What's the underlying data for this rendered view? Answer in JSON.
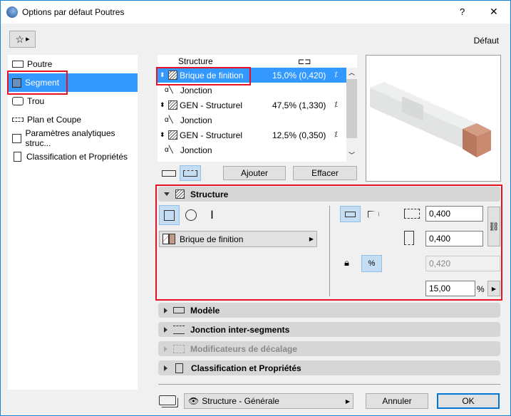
{
  "window": {
    "title": "Options par défaut Poutres",
    "help": "?",
    "close": "✕",
    "preset": "Défaut"
  },
  "sidebar": {
    "items": [
      {
        "label": "Poutre"
      },
      {
        "label": "Segment"
      },
      {
        "label": "Trou"
      },
      {
        "label": "Plan et Coupe"
      },
      {
        "label": "Paramètres analytiques struc..."
      },
      {
        "label": "Classification et Propriétés"
      }
    ]
  },
  "list": {
    "header": "Structure",
    "rows": [
      {
        "type": "segment",
        "name": "Brique de finition",
        "value": "15,0% (0,420)"
      },
      {
        "type": "joint",
        "name": "Jonction"
      },
      {
        "type": "segment",
        "name": "GEN - Structurel",
        "value": "47,5% (1,330)"
      },
      {
        "type": "joint",
        "name": "Jonction"
      },
      {
        "type": "segment",
        "name": "GEN - Structurel",
        "value": "12,5% (0,350)"
      },
      {
        "type": "joint",
        "name": "Jonction"
      }
    ],
    "add": "Ajouter",
    "delete": "Effacer"
  },
  "structure": {
    "title": "Structure",
    "material": "Brique de finition",
    "width": "0,400",
    "height": "0,400",
    "length": "0,420",
    "percent": "15,00",
    "percent_unit": "%",
    "percent_icon": "%",
    "material_color": "#c09a85"
  },
  "panels": [
    {
      "label": "Modèle",
      "disabled": false
    },
    {
      "label": "Jonction inter-segments",
      "disabled": false
    },
    {
      "label": "Modificateurs de décalage",
      "disabled": true
    },
    {
      "label": "Classification et Propriétés",
      "disabled": false
    }
  ],
  "footer": {
    "layer": "Structure - Générale",
    "cancel": "Annuler",
    "ok": "OK"
  }
}
